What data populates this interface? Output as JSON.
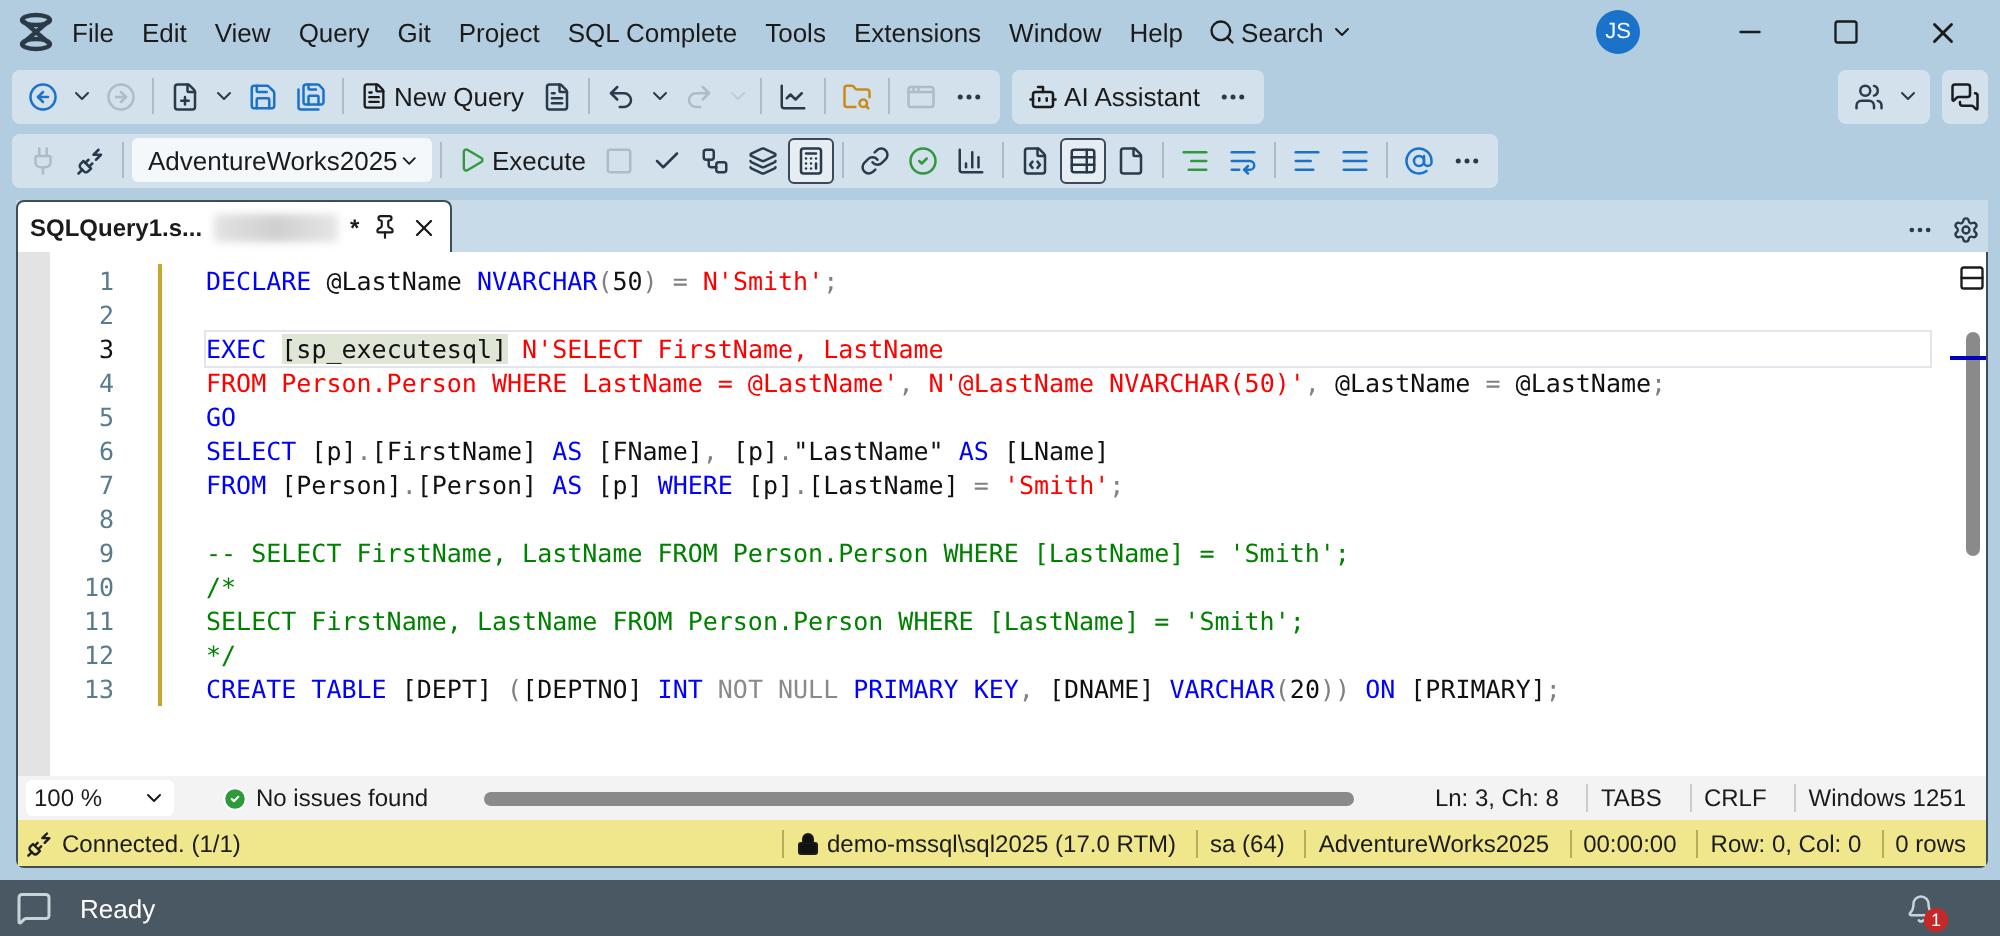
{
  "window": {
    "menu": [
      "File",
      "Edit",
      "View",
      "Query",
      "Git",
      "Project",
      "SQL Complete",
      "Tools",
      "Extensions",
      "Window",
      "Help"
    ],
    "search": "Search",
    "avatar": "JS"
  },
  "toolbar_main": [
    {
      "kind": "icon",
      "disabled": false
    },
    {
      "kind": "caret",
      "disabled": false
    },
    {
      "kind": "icon",
      "disabled": true
    },
    {
      "kind": "separator"
    },
    {
      "kind": "icon",
      "disabled": false
    },
    {
      "kind": "caret",
      "disabled": false
    },
    {
      "kind": "icon",
      "disabled": false
    },
    {
      "kind": "icon",
      "disabled": false
    },
    {
      "kind": "separator"
    },
    {
      "kind": "button",
      "label": "New Query",
      "disabled": false
    },
    {
      "kind": "icon",
      "disabled": false
    },
    {
      "kind": "separator"
    },
    {
      "kind": "icon",
      "disabled": false
    },
    {
      "kind": "caret",
      "disabled": false
    },
    {
      "kind": "icon",
      "disabled": true
    },
    {
      "kind": "caret",
      "disabled": true
    },
    {
      "kind": "separator"
    },
    {
      "kind": "icon",
      "disabled": false
    },
    {
      "kind": "separator"
    },
    {
      "kind": "icon",
      "disabled": false
    },
    {
      "kind": "separator"
    },
    {
      "kind": "icon",
      "disabled": true
    },
    {
      "kind": "icon",
      "disabled": false
    }
  ],
  "ai_toolbar": {
    "label": "AI Assistant"
  },
  "toolbar_query": [
    {
      "kind": "icon",
      "disabled": true,
      "pressed": false
    },
    {
      "kind": "icon",
      "disabled": false,
      "pressed": false
    },
    {
      "kind": "separator"
    },
    {
      "kind": "select",
      "value": "AdventureWorks2025"
    },
    {
      "kind": "separator"
    },
    {
      "kind": "button",
      "label": "Execute",
      "disabled": false
    },
    {
      "kind": "icon",
      "disabled": true,
      "pressed": false
    },
    {
      "kind": "icon",
      "disabled": false,
      "pressed": false
    },
    {
      "kind": "icon",
      "disabled": false,
      "pressed": false
    },
    {
      "kind": "icon",
      "disabled": false,
      "pressed": false
    },
    {
      "kind": "icon",
      "disabled": false,
      "pressed": true
    },
    {
      "kind": "separator"
    },
    {
      "kind": "icon",
      "disabled": false,
      "pressed": false
    },
    {
      "kind": "icon",
      "disabled": false,
      "pressed": false
    },
    {
      "kind": "icon",
      "disabled": false,
      "pressed": false
    },
    {
      "kind": "separator"
    },
    {
      "kind": "icon",
      "disabled": false,
      "pressed": false
    },
    {
      "kind": "icon",
      "disabled": false,
      "pressed": true
    },
    {
      "kind": "icon",
      "disabled": false,
      "pressed": false
    },
    {
      "kind": "separator"
    },
    {
      "kind": "icon",
      "disabled": false,
      "pressed": false
    },
    {
      "kind": "icon",
      "disabled": false,
      "pressed": false
    },
    {
      "kind": "separator"
    },
    {
      "kind": "icon",
      "disabled": false,
      "pressed": false
    },
    {
      "kind": "icon",
      "disabled": false,
      "pressed": false
    },
    {
      "kind": "separator"
    },
    {
      "kind": "icon",
      "disabled": false,
      "pressed": false
    },
    {
      "kind": "icon",
      "disabled": false,
      "pressed": false
    }
  ],
  "tabs": [
    {
      "title": "SQLQuery1.s...",
      "modified": "*",
      "selected": true
    }
  ],
  "editor": {
    "lines": [
      {
        "number": "1",
        "changed": true,
        "tokens": [
          {
            "kind": "kw",
            "text": "DECLARE"
          },
          {
            "kind": "txt",
            "text": " @LastName "
          },
          {
            "kind": "kw",
            "text": "NVARCHAR"
          },
          {
            "kind": "op",
            "text": "("
          },
          {
            "kind": "txt",
            "text": "50"
          },
          {
            "kind": "op",
            "text": ") = "
          },
          {
            "kind": "str",
            "text": "N'Smith'"
          },
          {
            "kind": "op",
            "text": ";"
          }
        ]
      },
      {
        "number": "2",
        "changed": true
      },
      {
        "number": "3",
        "changed": true,
        "current": true,
        "tokens": [
          {
            "kind": "kw",
            "text": "EXEC "
          },
          {
            "kind": "hl",
            "text": "[sp_executesql]"
          },
          {
            "kind": "str",
            "text": " N'SELECT FirstName, LastName"
          }
        ]
      },
      {
        "number": "4",
        "changed": true,
        "tokens": [
          {
            "kind": "str",
            "text": "FROM Person.Person WHERE LastName = @LastName'"
          },
          {
            "kind": "op",
            "text": ", "
          },
          {
            "kind": "str",
            "text": "N'@LastName NVARCHAR(50)'"
          },
          {
            "kind": "op",
            "text": ", "
          },
          {
            "kind": "txt",
            "text": "@LastName "
          },
          {
            "kind": "op",
            "text": "= "
          },
          {
            "kind": "txt",
            "text": "@LastName"
          },
          {
            "kind": "op",
            "text": ";"
          }
        ]
      },
      {
        "number": "5",
        "changed": true,
        "tokens": [
          {
            "kind": "kw",
            "text": "GO"
          }
        ]
      },
      {
        "number": "6",
        "changed": true,
        "tokens": [
          {
            "kind": "kw",
            "text": "SELECT"
          },
          {
            "kind": "txt",
            "text": " [p]"
          },
          {
            "kind": "op",
            "text": "."
          },
          {
            "kind": "txt",
            "text": "[FirstName] "
          },
          {
            "kind": "kw",
            "text": "AS"
          },
          {
            "kind": "txt",
            "text": " [FName]"
          },
          {
            "kind": "op",
            "text": ", "
          },
          {
            "kind": "txt",
            "text": "[p]"
          },
          {
            "kind": "op",
            "text": "."
          },
          {
            "kind": "txt",
            "text": "\"LastName\" "
          },
          {
            "kind": "kw",
            "text": "AS"
          },
          {
            "kind": "txt",
            "text": " [LName]"
          }
        ]
      },
      {
        "number": "7",
        "changed": true,
        "tokens": [
          {
            "kind": "kw",
            "text": "FROM"
          },
          {
            "kind": "txt",
            "text": " [Person]"
          },
          {
            "kind": "op",
            "text": "."
          },
          {
            "kind": "txt",
            "text": "[Person] "
          },
          {
            "kind": "kw",
            "text": "AS"
          },
          {
            "kind": "txt",
            "text": " [p] "
          },
          {
            "kind": "kw",
            "text": "WHERE"
          },
          {
            "kind": "txt",
            "text": " [p]"
          },
          {
            "kind": "op",
            "text": "."
          },
          {
            "kind": "txt",
            "text": "[LastName] "
          },
          {
            "kind": "op",
            "text": "= "
          },
          {
            "kind": "str",
            "text": "'Smith'"
          },
          {
            "kind": "op",
            "text": ";"
          }
        ]
      },
      {
        "number": "8",
        "changed": true
      },
      {
        "number": "9",
        "changed": true,
        "tokens": [
          {
            "kind": "cmt",
            "text": "-- SELECT FirstName, LastName FROM Person.Person WHERE [LastName] = 'Smith';"
          }
        ]
      },
      {
        "number": "10",
        "changed": true,
        "tokens": [
          {
            "kind": "cmt",
            "text": "/*"
          }
        ]
      },
      {
        "number": "11",
        "changed": true,
        "tokens": [
          {
            "kind": "cmt",
            "text": "SELECT FirstName, LastName FROM Person.Person WHERE [LastName] = 'Smith';"
          }
        ]
      },
      {
        "number": "12",
        "changed": true,
        "tokens": [
          {
            "kind": "cmt",
            "text": "*/"
          }
        ]
      },
      {
        "number": "13",
        "changed": true,
        "tokens": [
          {
            "kind": "kw",
            "text": "CREATE TABLE"
          },
          {
            "kind": "txt",
            "text": " [DEPT] "
          },
          {
            "kind": "op",
            "text": "("
          },
          {
            "kind": "txt",
            "text": "[DEPTNO] "
          },
          {
            "kind": "kw",
            "text": "INT"
          },
          {
            "kind": "dim",
            "text": " NOT NULL"
          },
          {
            "kind": "kw",
            "text": " PRIMARY KEY"
          },
          {
            "kind": "op",
            "text": ", "
          },
          {
            "kind": "txt",
            "text": "[DNAME] "
          },
          {
            "kind": "kw",
            "text": "VARCHAR"
          },
          {
            "kind": "op",
            "text": "("
          },
          {
            "kind": "txt",
            "text": "20"
          },
          {
            "kind": "op",
            "text": "))"
          },
          {
            "kind": "kw",
            "text": " ON"
          },
          {
            "kind": "txt",
            "text": " [PRIMARY]"
          },
          {
            "kind": "op",
            "text": ";"
          }
        ]
      }
    ]
  },
  "editor_status": {
    "zoom": "100 %",
    "issues": "No issues found",
    "fields": [
      "Ln: 3, Ch: 8",
      "TABS",
      "CRLF",
      "Windows 1251"
    ]
  },
  "connection_bar": {
    "status": "Connected. (1/1)",
    "fields": [
      "demo-mssql\\sql2025 (17.0 RTM)",
      "sa (64)",
      "AdventureWorks2025",
      "00:00:00",
      "Row: 0, Col: 0",
      "0 rows"
    ]
  },
  "status_bar": {
    "text": "Ready",
    "notifications": "1"
  }
}
